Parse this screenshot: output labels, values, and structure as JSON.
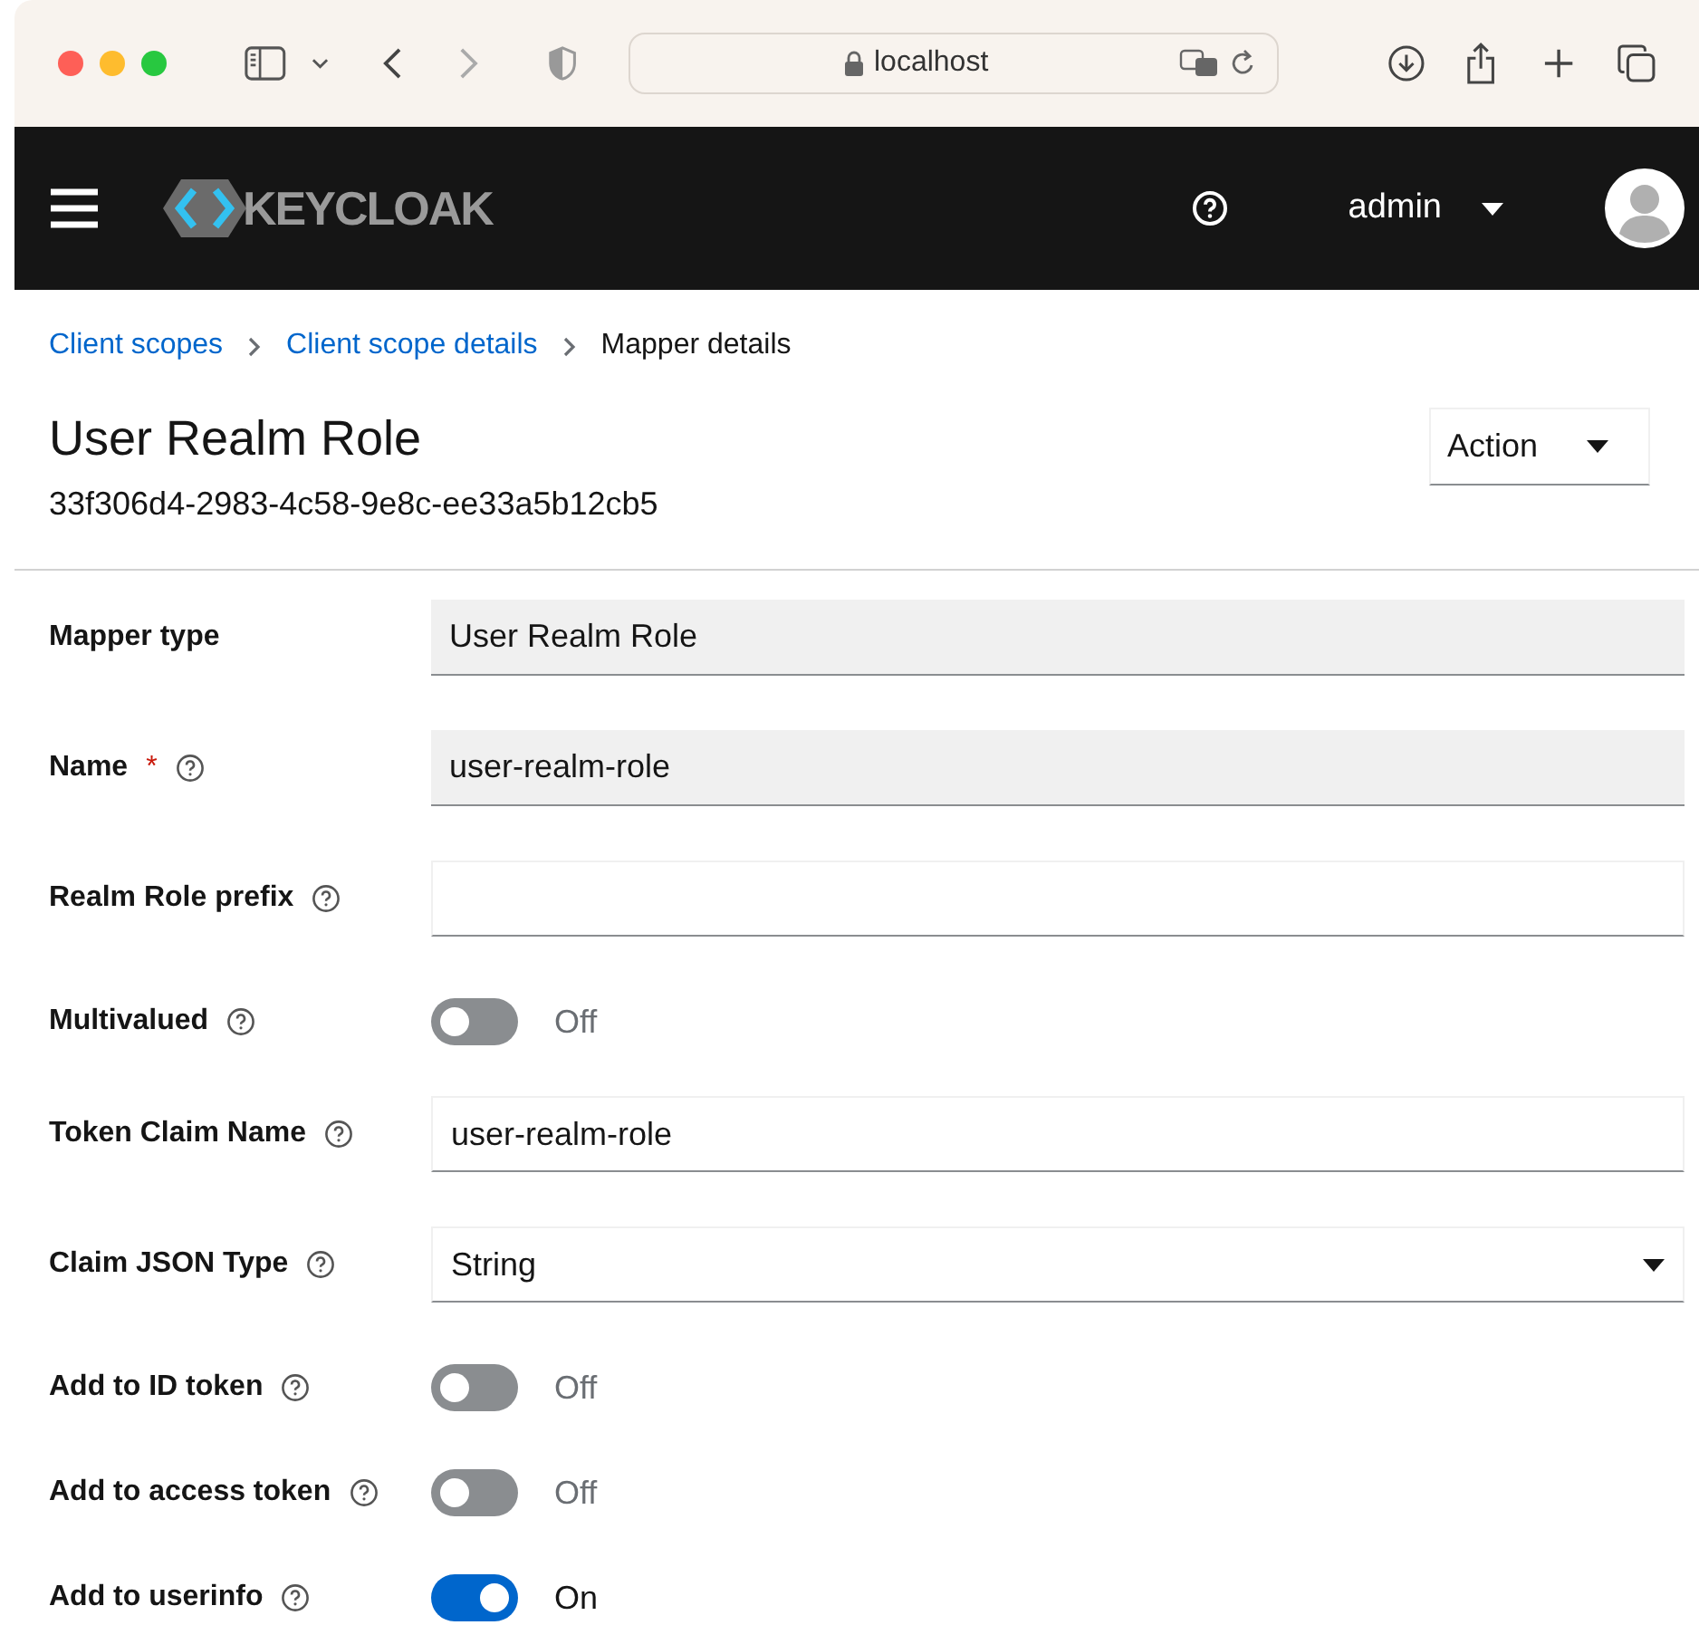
{
  "browser": {
    "url": "localhost"
  },
  "header": {
    "brand": "KEYCLOAK",
    "user": "admin"
  },
  "breadcrumbs": [
    {
      "label": "Client scopes",
      "link": true
    },
    {
      "label": "Client scope details",
      "link": true
    },
    {
      "label": "Mapper details",
      "link": false
    }
  ],
  "title": "User Realm Role",
  "subtitle": "33f306d4-2983-4c58-9e8c-ee33a5b12cb5",
  "action_button": "Action",
  "fields": [
    {
      "label": "Mapper type",
      "kind": "readonly",
      "required": false,
      "help": false,
      "value": "User Realm Role"
    },
    {
      "label": "Name",
      "kind": "readonly",
      "required_mark": "*",
      "required": true,
      "help": true,
      "value": "user-realm-role"
    },
    {
      "label": "Realm Role prefix",
      "kind": "text",
      "required": false,
      "help": true
    },
    {
      "label": "Multivalued",
      "kind": "switch",
      "required": false,
      "help": true,
      "on": false,
      "state_label": "Off"
    },
    {
      "label": "Token Claim Name",
      "kind": "text",
      "required": false,
      "help": true,
      "value": "user-realm-role"
    },
    {
      "label": "Claim JSON Type",
      "kind": "select",
      "required": false,
      "help": true,
      "value": "String"
    },
    {
      "label": "Add to ID token",
      "kind": "switch",
      "required": false,
      "help": true,
      "on": false,
      "state_label": "Off"
    },
    {
      "label": "Add to access token",
      "kind": "switch",
      "required": false,
      "help": true,
      "on": false,
      "state_label": "Off"
    },
    {
      "label": "Add to userinfo",
      "kind": "switch",
      "required": false,
      "help": true,
      "on": true,
      "state_label": "On"
    }
  ]
}
